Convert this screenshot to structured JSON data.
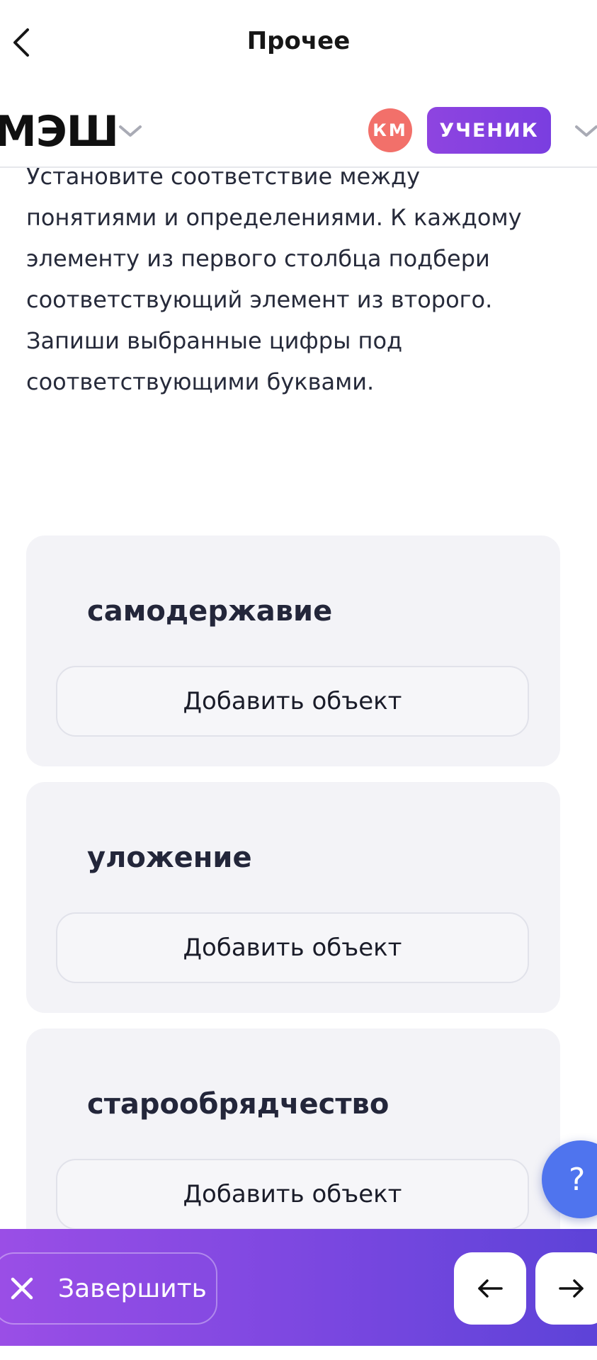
{
  "topbar": {
    "title": "Прочее"
  },
  "header": {
    "logo_text": "МЭШ",
    "avatar_initials": "КМ",
    "role_label": "УЧЕНИК",
    "colors": {
      "avatar": "#f2706a",
      "role_badge": "#8e44e0"
    }
  },
  "question": {
    "lines": [
      "Установите соответствие между",
      "понятиями и определениями. К каждому",
      "элементу из первого столбца подбери",
      "соответствующий элемент из второго.",
      "Запиши выбранные цифры под",
      "соответствующими буквами."
    ]
  },
  "cards": [
    {
      "term": "самодержавие",
      "add_label": "Добавить объект"
    },
    {
      "term": "уложение",
      "add_label": "Добавить объект"
    },
    {
      "term": "старообрядчество",
      "add_label": "Добавить объект"
    }
  ],
  "help": {
    "icon": "question-mark-icon",
    "label": "?"
  },
  "bottombar": {
    "finish_label": "Завершить",
    "prev_icon": "arrow-left-icon",
    "next_icon": "arrow-right-icon",
    "accent_colors": [
      "#9a4ee6",
      "#5d43d8"
    ]
  }
}
